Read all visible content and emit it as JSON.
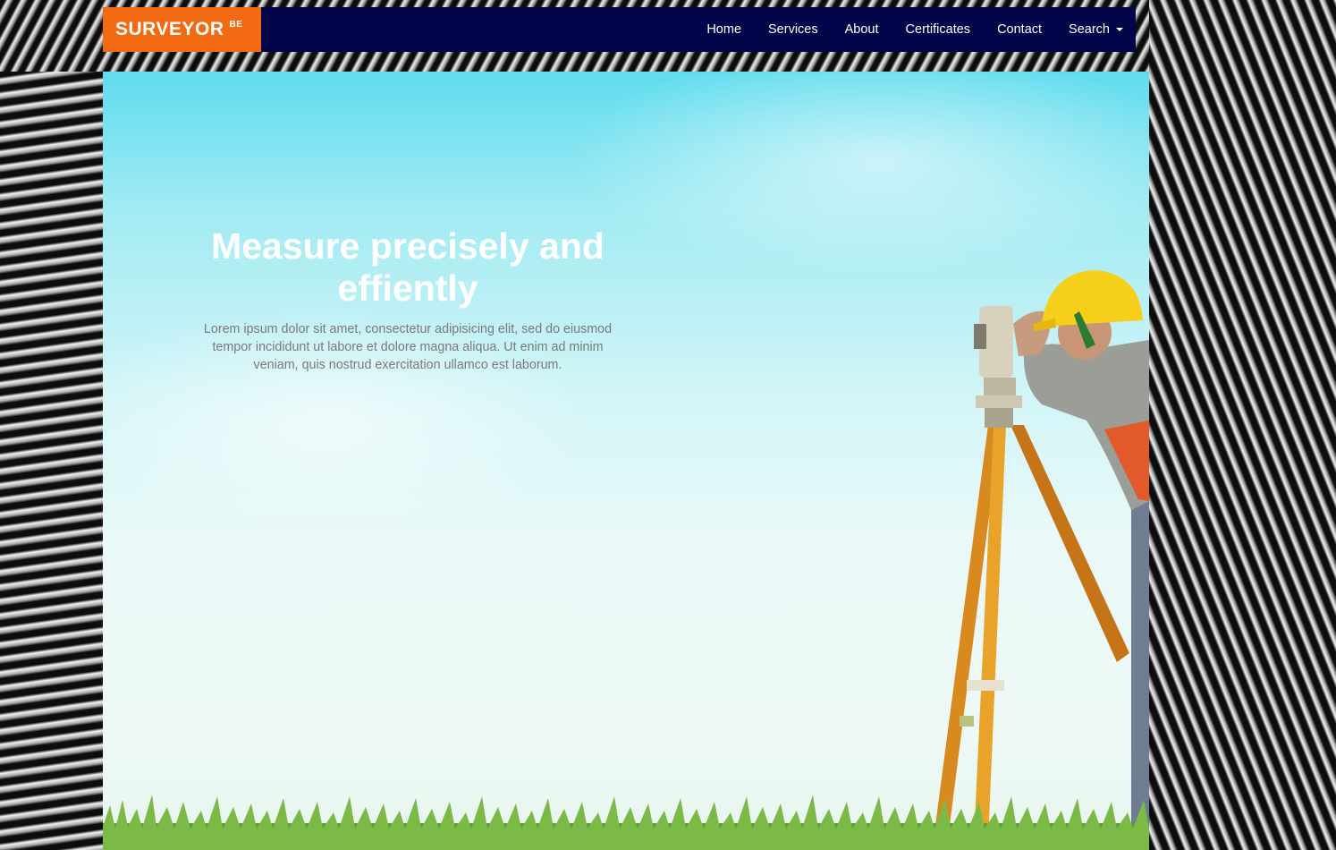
{
  "brand": {
    "name": "SURVEYOR",
    "suffix": "BE"
  },
  "nav": {
    "items": [
      "Home",
      "Services",
      "About",
      "Certificates",
      "Contact",
      "Search"
    ]
  },
  "hero": {
    "title": "Measure precisely and effiently",
    "description": "Lorem ipsum dolor sit amet, consectetur adipisicing elit, sed do eiusmod tempor incididunt ut labore et dolore magna aliqua. Ut enim ad minim veniam, quis nostrud exercitation ullamco est laborum."
  },
  "colors": {
    "brand_bg": "#f26a12",
    "navbar_bg": "#03054a",
    "sky": "#5fdcee",
    "helmet": "#f5cf1a"
  },
  "icons": {
    "search_caret": "caret-down-icon"
  }
}
